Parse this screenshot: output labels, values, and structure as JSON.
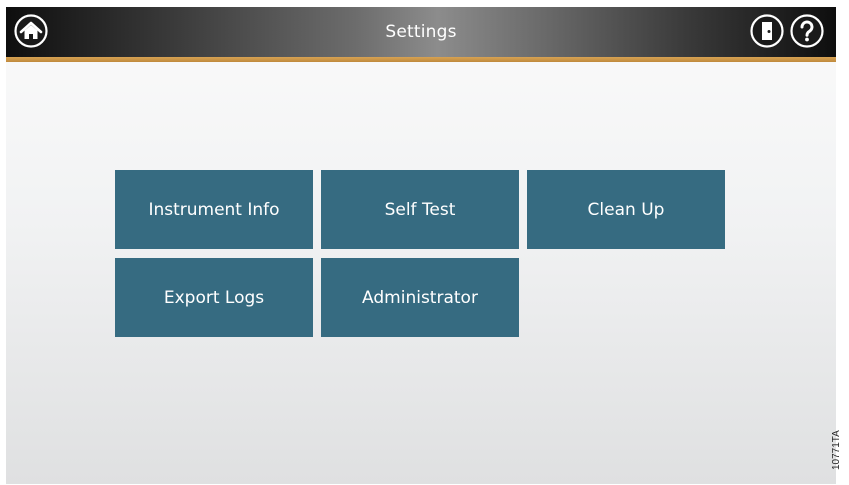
{
  "header": {
    "title": "Settings",
    "home_icon": "home-icon",
    "logout_icon": "logout-door-icon",
    "help_icon": "help-question-icon"
  },
  "menu": {
    "items": [
      {
        "label": "Instrument Info"
      },
      {
        "label": "Self Test"
      },
      {
        "label": "Clean Up"
      },
      {
        "label": "Export Logs"
      },
      {
        "label": "Administrator"
      }
    ]
  },
  "figure_id": "10771TA",
  "colors": {
    "tile": "#366b81",
    "accent": "#c99445",
    "titlebar_dark": "#0e0e0e"
  }
}
